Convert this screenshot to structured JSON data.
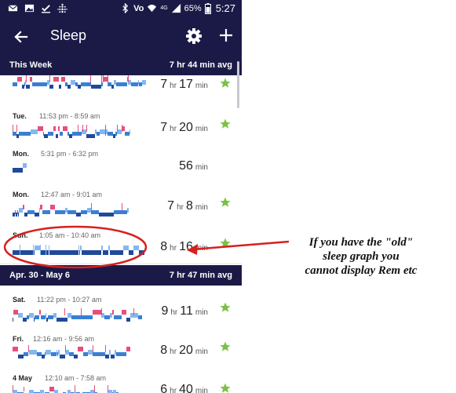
{
  "status_bar": {
    "left_icons": [
      "mail-icon",
      "image-icon",
      "check-icon",
      "fitbit-icon"
    ],
    "right_icons": [
      "bluetooth-icon",
      "volte-icon",
      "wifi-icon",
      "signal-icon",
      "battery-icon"
    ],
    "volte": "Vo",
    "network": "4G",
    "battery_pct": "65%",
    "time": "5:27"
  },
  "app_bar": {
    "title": "Sleep"
  },
  "sections": [
    {
      "label": "This Week",
      "avg": "7 hr 44 min avg"
    },
    {
      "label": "Apr. 30 - May 6",
      "avg": "7 hr 47 min avg"
    }
  ],
  "entries": [
    {
      "day": "",
      "range": "",
      "hours": "7",
      "hr_unit": "hr",
      "minutes": "17",
      "min_unit": "min",
      "star": true
    },
    {
      "day": "Tue.",
      "range": "11:53 pm - 8:59 am",
      "hours": "7",
      "hr_unit": "hr",
      "minutes": "20",
      "min_unit": "min",
      "star": true
    },
    {
      "day": "Mon.",
      "range": "5:31 pm - 6:32 pm",
      "hours": "",
      "hr_unit": "",
      "minutes": "56",
      "min_unit": "min",
      "star": false
    },
    {
      "day": "Mon.",
      "range": "12:47 am - 9:01 am",
      "hours": "7",
      "hr_unit": "hr",
      "minutes": "8",
      "min_unit": "min",
      "star": true
    },
    {
      "day": "Sun.",
      "range": "1:05 am - 10:40 am",
      "hours": "8",
      "hr_unit": "hr",
      "minutes": "16",
      "min_unit": "min",
      "star": true
    },
    {
      "day": "Sat.",
      "range": "11:22 pm - 10:27 am",
      "hours": "9",
      "hr_unit": "hr",
      "minutes": "11",
      "min_unit": "min",
      "star": true
    },
    {
      "day": "Fri.",
      "range": "12:16 am - 9:56 am",
      "hours": "8",
      "hr_unit": "hr",
      "minutes": "20",
      "min_unit": "min",
      "star": true
    },
    {
      "day": "4 May",
      "range": "12:10 am - 7:58 am",
      "hours": "6",
      "hr_unit": "hr",
      "minutes": "40",
      "min_unit": "min",
      "star": true
    }
  ],
  "annotation": {
    "line1": "If you have the \"old\"",
    "line2": "sleep graph you",
    "line3": "cannot display Rem etc"
  },
  "colors": {
    "header_bg": "#1b1a47",
    "wake": "#e84e7b",
    "rem": "#83b8f0",
    "light": "#3a7fd5",
    "deep": "#1f4a9a",
    "star": "#7ac143",
    "annotation_red": "#d6201f"
  }
}
